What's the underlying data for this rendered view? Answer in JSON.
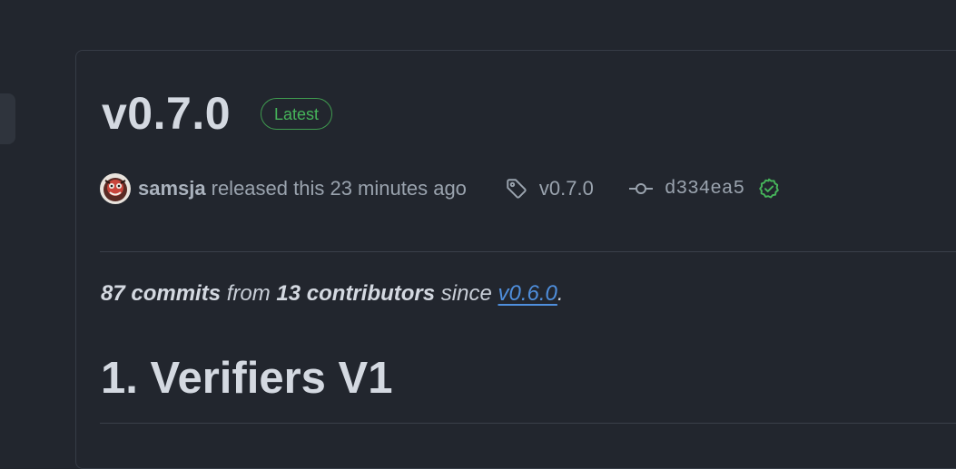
{
  "release": {
    "title": "v0.7.0",
    "badge": "Latest",
    "author": "samsja",
    "released_text": "released this 23 minutes ago",
    "tag": "v0.7.0",
    "commit": "d334ea5",
    "verified": true
  },
  "summary": {
    "commits": "87 commits",
    "from": " from ",
    "contributors": "13 contributors",
    "since": " since ",
    "since_link": "v0.6.0",
    "end": "."
  },
  "section": {
    "heading": "1. Verifiers V1"
  },
  "colors": {
    "background": "#22262e",
    "badge_green": "#46b45a",
    "link_blue": "#4f8fdd"
  },
  "icons": {
    "avatar": "avatar",
    "tag": "tag-icon",
    "commit": "git-commit-icon",
    "verified": "verified-check-icon"
  }
}
